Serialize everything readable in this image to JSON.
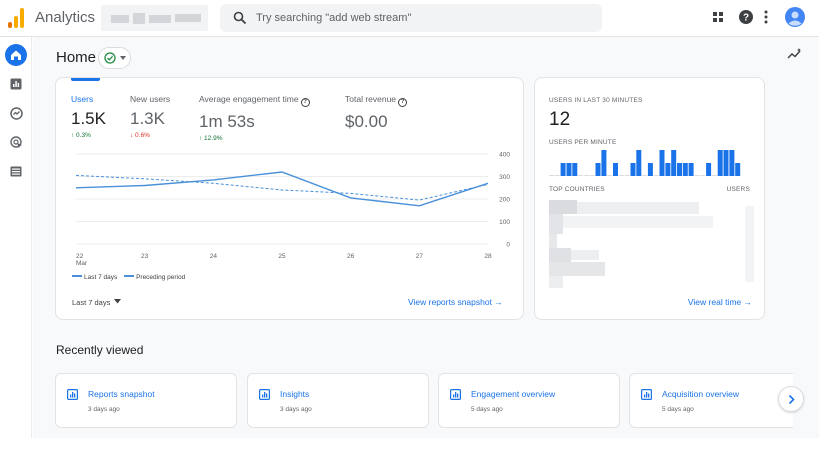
{
  "app": {
    "title": "Analytics",
    "brand_color": "#f9ab00"
  },
  "search": {
    "placeholder": "Try searching \"add web stream\""
  },
  "header_icons": [
    "apps-grid-icon",
    "help-icon",
    "more-vert-icon",
    "account-avatar-icon"
  ],
  "nav": [
    "home-icon",
    "reports-icon",
    "explore-icon",
    "advertising-icon",
    "configure-icon"
  ],
  "page": {
    "title": "Home"
  },
  "metrics": [
    {
      "label": "Users",
      "value": "1.5K",
      "change": "↑ 0.3%",
      "direction": "up"
    },
    {
      "label": "New users",
      "value": "1.3K",
      "change": "↓ 0.6%",
      "direction": "down"
    },
    {
      "label": "Average engagement time",
      "value": "1m 53s",
      "change": "↑ 12.9%",
      "direction": "up"
    },
    {
      "label": "Total revenue",
      "value": "$0.00",
      "change": "",
      "direction": "none"
    }
  ],
  "chart_data": {
    "type": "line",
    "categories": [
      "22",
      "23",
      "24",
      "25",
      "26",
      "27",
      "28"
    ],
    "x_sublabel": "Mar",
    "y_ticks": [
      0,
      100,
      200,
      300,
      400
    ],
    "ylim": [
      0,
      400
    ],
    "series": [
      {
        "name": "Last 7 days",
        "style": "solid",
        "color": "#4a90d9",
        "values": [
          250,
          260,
          285,
          320,
          205,
          170,
          270
        ]
      },
      {
        "name": "Preceding period",
        "style": "dashed",
        "color": "#4a90d9",
        "values": [
          305,
          290,
          270,
          240,
          225,
          195,
          265
        ]
      }
    ],
    "legend": {
      "position": "bottom-left",
      "labels": [
        "Last 7 days",
        "Preceding period"
      ]
    },
    "grid": true
  },
  "main_card": {
    "date_range": "Last 7 days",
    "link": "View reports snapshot →"
  },
  "realtime": {
    "caption": "USERS IN LAST 30 MINUTES",
    "value": "12",
    "per_minute_label": "USERS PER MINUTE",
    "per_minute_values": [
      0,
      0,
      1,
      1,
      1,
      0,
      0,
      0,
      1,
      2,
      0,
      1,
      0,
      0,
      1,
      2,
      0,
      1,
      0,
      2,
      1,
      2,
      1,
      1,
      1,
      0,
      0,
      1,
      0,
      2,
      2,
      2,
      1
    ],
    "countries_label": "TOP COUNTRIES",
    "users_label": "USERS",
    "link": "View real time →"
  },
  "recent": {
    "title": "Recently viewed",
    "items": [
      {
        "title": "Reports snapshot",
        "sub": "3 days ago"
      },
      {
        "title": "Insights",
        "sub": "3 days ago"
      },
      {
        "title": "Engagement overview",
        "sub": "5 days ago"
      },
      {
        "title": "Acquisition overview",
        "sub": "5 days ago"
      }
    ]
  },
  "colors": {
    "accent": "#1a73e8",
    "up": "#137333",
    "down": "#d93025",
    "bars": "#1a73e8"
  }
}
